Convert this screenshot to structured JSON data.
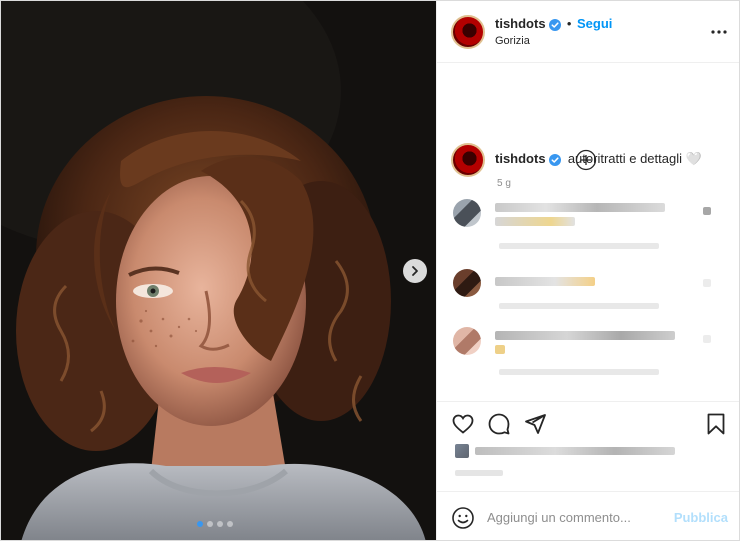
{
  "post": {
    "author": {
      "username": "tishdots",
      "verified": true,
      "location": "Gorizia"
    },
    "follow_label": "Segui",
    "separator": "•",
    "more_icon": "more-horizontal-icon",
    "caption": {
      "username": "tishdots",
      "text": "autoritratti e dettagli 🤍",
      "time": "5 g"
    },
    "load_more_icon": "plus-circle-icon",
    "carousel": {
      "slide_count": 4,
      "active_index": 0,
      "next_icon": "chevron-right-icon"
    },
    "actions": {
      "like_icon": "heart-icon",
      "comment_icon": "comment-icon",
      "share_icon": "paper-plane-icon",
      "save_icon": "bookmark-icon"
    },
    "add_comment": {
      "placeholder": "Aggiungi un commento...",
      "submit_label": "Pubblica",
      "emoji_icon": "emoji-icon"
    }
  },
  "colors": {
    "accent": "#0095f6",
    "publish_disabled": "#b2dffc",
    "verified": "#3897f0",
    "text": "#262626",
    "muted": "#8e8e8e"
  }
}
